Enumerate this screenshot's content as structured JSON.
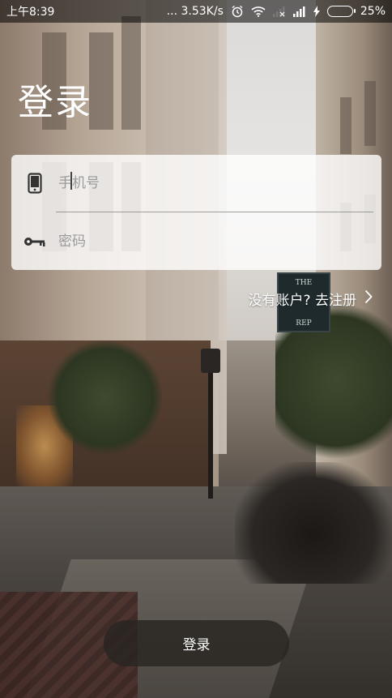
{
  "statusbar": {
    "time": "上午8:39",
    "network_speed": "... 3.53K/s",
    "battery_percent": "25%",
    "battery_level": 0.25,
    "icons": [
      "alarm-icon",
      "wifi-icon",
      "signal-weak-icon",
      "signal-icon",
      "charging-icon",
      "battery-icon"
    ]
  },
  "page": {
    "title": "登录"
  },
  "form": {
    "phone": {
      "placeholder": "手机号",
      "value": "",
      "icon": "phone-icon"
    },
    "password": {
      "placeholder": "密码",
      "value": "",
      "icon": "key-icon"
    }
  },
  "register_link": {
    "label": "没有账户? 去注册",
    "icon": "chevron-right-icon"
  },
  "login_button": {
    "label": "登录"
  },
  "colors": {
    "card_bg": "rgba(255,255,255,0.80)",
    "button_bg": "#28241f",
    "battery_fill": "#3ddc3d",
    "text_light": "#ffffff"
  }
}
